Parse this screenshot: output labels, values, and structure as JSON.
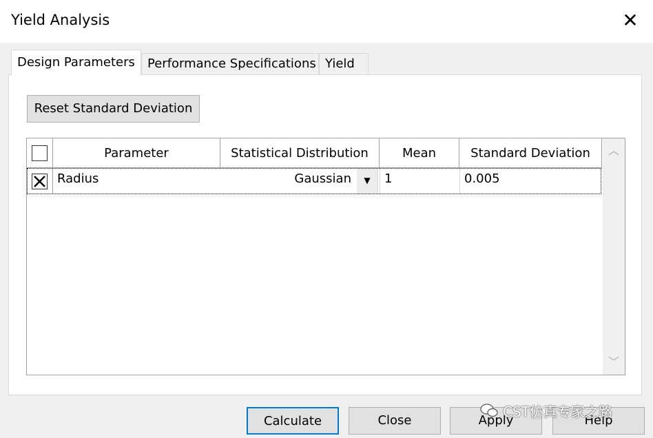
{
  "window": {
    "title": "Yield Analysis"
  },
  "tabs": [
    {
      "label": "Design Parameters"
    },
    {
      "label": "Performance Specifications"
    },
    {
      "label": "Yield"
    }
  ],
  "reset_button": {
    "label": "Reset Standard Deviation"
  },
  "table": {
    "columns": [
      "Parameter",
      "Statistical Distribution",
      "Mean",
      "Standard Deviation"
    ],
    "rows": [
      {
        "checked": true,
        "parameter": "Radius",
        "distribution": "Gaussian",
        "mean": "1",
        "std_dev": "0.005"
      }
    ]
  },
  "footer": {
    "calculate": "Calculate",
    "close": "Close",
    "apply": "Apply",
    "help": "Help"
  },
  "watermark": {
    "text": "CST仿真专家之路"
  },
  "colors": {
    "focus_border": "#0078d7",
    "button_bg": "#e1e1e1",
    "dialog_bg": "#f0f0f0"
  }
}
